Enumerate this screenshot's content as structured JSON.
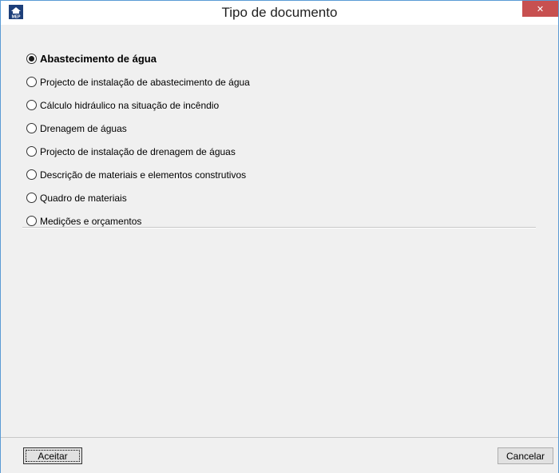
{
  "window": {
    "title": "Tipo de documento",
    "app_icon": "MEP",
    "close_glyph": "✕"
  },
  "options": [
    {
      "label": "Abastecimento de água",
      "selected": true
    },
    {
      "label": "Projecto de instalação de abastecimento de água",
      "selected": false
    },
    {
      "label": "Cálculo hidráulico na situação de incêndio",
      "selected": false
    },
    {
      "label": "Drenagem de águas",
      "selected": false
    },
    {
      "label": "Projecto de instalação de drenagem de águas",
      "selected": false
    },
    {
      "label": "Descrição de materiais e elementos construtivos",
      "selected": false
    },
    {
      "label": "Quadro de materiais",
      "selected": false
    },
    {
      "label": "Medições e orçamentos",
      "selected": false
    }
  ],
  "footer": {
    "accept_label": "Aceitar",
    "cancel_label": "Cancelar"
  },
  "colors": {
    "close_button": "#c75050",
    "window_border": "#5a9bd5",
    "background": "#f0f0f0"
  }
}
